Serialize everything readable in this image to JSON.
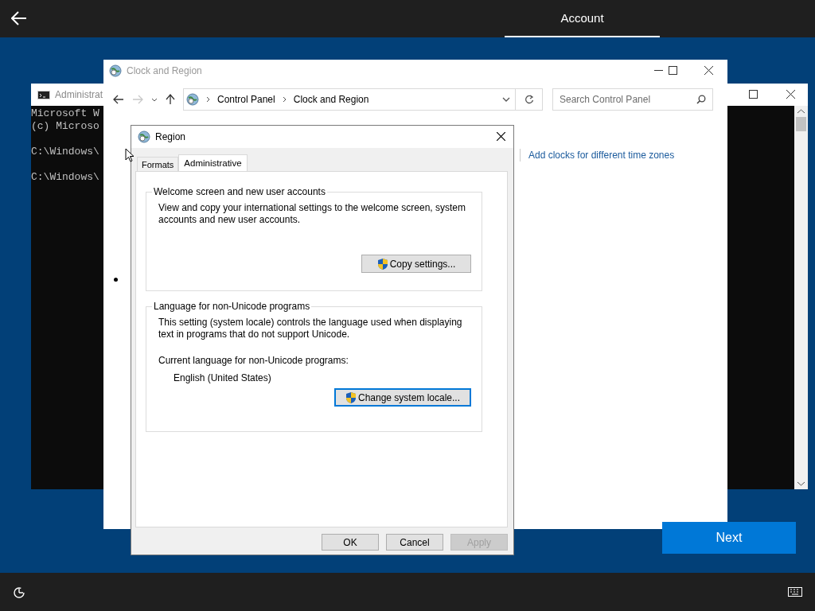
{
  "top_bar": {
    "steps": [
      {
        "label": "Account",
        "selected": true
      }
    ]
  },
  "cmd_window": {
    "title": "Administrat",
    "blocks": [
      [
        "Microsoft W",
        "(c) Microso"
      ],
      [
        "C:\\Windows\\"
      ],
      [
        "C:\\Windows\\"
      ]
    ]
  },
  "control_panel": {
    "title": "Clock and Region",
    "breadcrumb": [
      "Control Panel",
      "Clock and Region"
    ],
    "search": {
      "placeholder": "Search Control Panel"
    },
    "link": "Add clocks for different time zones"
  },
  "region_dialog": {
    "title": "Region",
    "tabs": [
      {
        "label": "Formats",
        "selected": false
      },
      {
        "label": "Administrative",
        "selected": true
      }
    ],
    "groups": [
      {
        "title": "Welcome screen and new user accounts",
        "description": "View and copy your international settings to the welcome screen, system accounts and new user accounts.",
        "button": {
          "label": "Copy settings...",
          "focused": false
        }
      },
      {
        "title": "Language for non-Unicode programs",
        "description": "This setting (system locale) controls the language used when displaying text in programs that do not support Unicode.",
        "current_label": "Current language for non-Unicode programs:",
        "current_value": "English (United States)",
        "button": {
          "label": "Change system locale...",
          "focused": true
        }
      }
    ],
    "buttons": [
      {
        "label": "OK",
        "disabled": false
      },
      {
        "label": "Cancel",
        "disabled": false
      },
      {
        "label": "Apply",
        "disabled": true
      }
    ]
  },
  "next_button": {
    "label": "Next"
  }
}
